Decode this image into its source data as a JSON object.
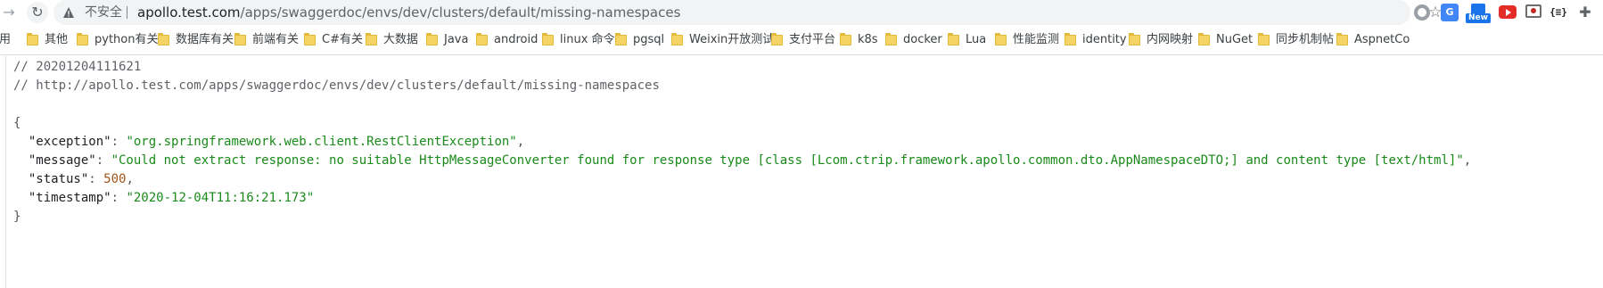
{
  "browser": {
    "security_label": "不安全",
    "url_host": "apollo.test.com",
    "url_path": "/apps/swaggerdoc/envs/dev/clusters/default/missing-namespaces",
    "extensions": {
      "translate_glyph": "G",
      "new_badge": "New",
      "json_glyph": "{≡}"
    }
  },
  "bookmarks": [
    {
      "label": "应用",
      "icon": "apps-icon"
    },
    {
      "label": "其他",
      "icon": "folder-icon"
    },
    {
      "label": "python有关",
      "icon": "folder-icon"
    },
    {
      "label": "数据库有关",
      "icon": "folder-icon"
    },
    {
      "label": "前端有关",
      "icon": "folder-icon"
    },
    {
      "label": "C#有关",
      "icon": "folder-icon"
    },
    {
      "label": "大数据",
      "icon": "folder-icon"
    },
    {
      "label": "Java",
      "icon": "folder-icon"
    },
    {
      "label": "android",
      "icon": "folder-icon"
    },
    {
      "label": "linux 命令",
      "icon": "folder-icon"
    },
    {
      "label": "pgsql",
      "icon": "folder-icon"
    },
    {
      "label": "Weixin开放测试",
      "icon": "folder-icon"
    },
    {
      "label": "支付平台",
      "icon": "folder-icon"
    },
    {
      "label": "k8s",
      "icon": "folder-icon"
    },
    {
      "label": "docker",
      "icon": "folder-icon"
    },
    {
      "label": "Lua",
      "icon": "folder-icon"
    },
    {
      "label": "性能监测",
      "icon": "folder-icon"
    },
    {
      "label": "identity",
      "icon": "folder-icon"
    },
    {
      "label": "内网映射",
      "icon": "folder-icon"
    },
    {
      "label": "NuGet",
      "icon": "folder-icon"
    },
    {
      "label": "同步机制帖",
      "icon": "folder-icon"
    },
    {
      "label": "AspnetCo",
      "icon": "folder-icon"
    }
  ],
  "json_view": {
    "comment_timestamp": "// 20201204111621",
    "comment_url": "// http://apollo.test.com/apps/swaggerdoc/envs/dev/clusters/default/missing-namespaces",
    "open_brace": "{",
    "close_brace": "}",
    "entries": [
      {
        "key": "\"exception\"",
        "value": "\"org.springframework.web.client.RestClientException\"",
        "type": "string",
        "trail": ","
      },
      {
        "key": "\"message\"",
        "value": "\"Could not extract response: no suitable HttpMessageConverter found for response type [class [Lcom.ctrip.framework.apollo.common.dto.AppNamespaceDTO;] and content type [text/html]\"",
        "type": "string",
        "trail": ","
      },
      {
        "key": "\"status\"",
        "value": "500",
        "type": "number",
        "trail": ","
      },
      {
        "key": "\"timestamp\"",
        "value": "\"2020-12-04T11:16:21.173\"",
        "type": "string",
        "trail": ""
      }
    ]
  }
}
